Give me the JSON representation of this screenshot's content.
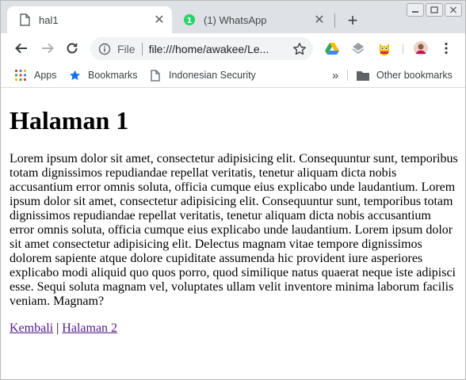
{
  "window_controls": [
    "minimize",
    "maximize",
    "close"
  ],
  "tabs": [
    {
      "title": "hal1",
      "icon": "document-icon",
      "active": true
    },
    {
      "title": "(1) WhatsApp",
      "icon": "whatsapp-icon",
      "active": false
    }
  ],
  "toolbar": {
    "scheme_label": "File",
    "url": "file:///home/awakee/Le..."
  },
  "bookmarks": [
    {
      "label": "Apps",
      "icon": "apps-grid-icon"
    },
    {
      "label": "Bookmarks",
      "icon": "star-icon"
    },
    {
      "label": "Indonesian Security",
      "icon": "document-icon"
    }
  ],
  "bookmarks_overflow": "»",
  "other_bookmarks": "Other bookmarks",
  "page": {
    "heading": "Halaman 1",
    "paragraph": "Lorem ipsum dolor sit amet, consectetur adipisicing elit. Consequuntur sunt, temporibus totam dignissimos repudiandae repellat veritatis, tenetur aliquam dicta nobis accusantium error omnis soluta, officia cumque eius explicabo unde laudantium. Lorem ipsum dolor sit amet, consectetur adipisicing elit. Consequuntur sunt, temporibus totam dignissimos repudiandae repellat veritatis, tenetur aliquam dicta nobis accusantium error omnis soluta, officia cumque eius explicabo unde laudantium. Lorem ipsum dolor sit amet consectetur adipisicing elit. Delectus magnam vitae tempore dignissimos dolorem sapiente atque dolore cupiditate assumenda hic provident iure asperiores explicabo modi aliquid quo quos porro, quod similique natus quaerat neque iste adipisci esse. Sequi soluta magnam vel, voluptates ullam velit inventore minima laborum facilis veniam. Magnam?",
    "link_back": "Kembali",
    "link_separator": " | ",
    "link_next": "Halaman 2"
  },
  "colors": {
    "tabstrip_bg": "#dee1e6",
    "omnibox_bg": "#f1f3f4",
    "link_visited": "#551a8b",
    "whatsapp_green": "#25d366"
  }
}
